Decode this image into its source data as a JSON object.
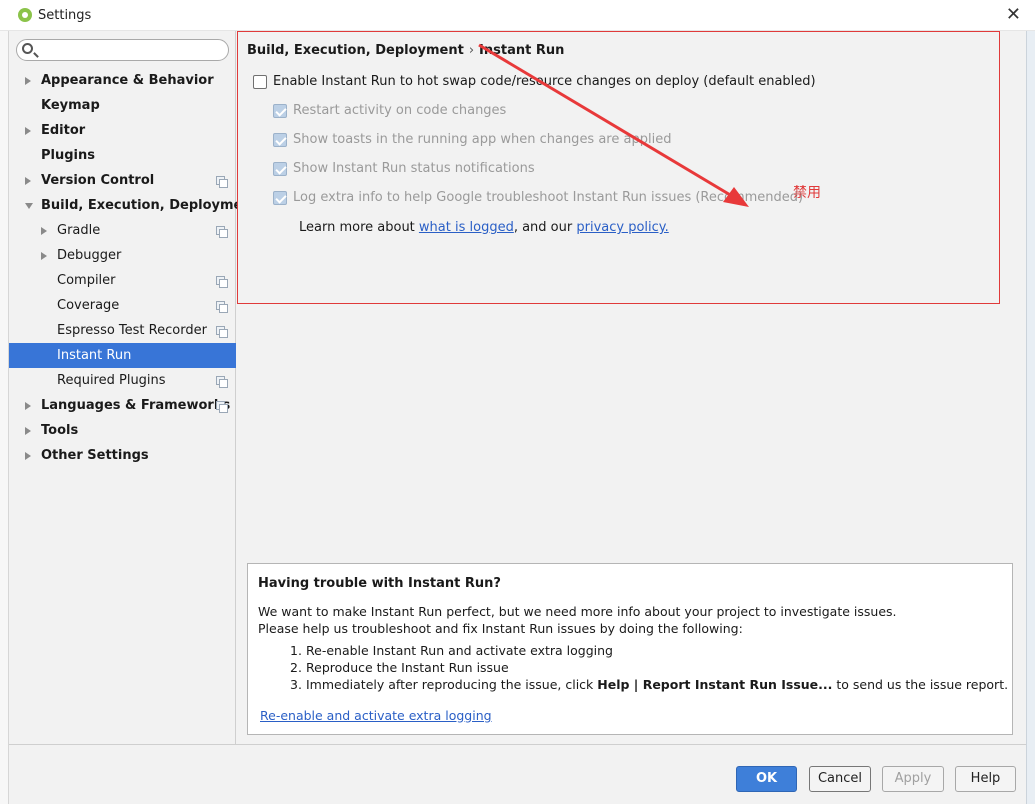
{
  "window": {
    "title": "Settings",
    "close_icon": "close-icon"
  },
  "search": {
    "value": "",
    "placeholder": ""
  },
  "sidebar": {
    "items": [
      {
        "label": "Appearance & Behavior",
        "bold": true,
        "arrow": "right",
        "indent": 0,
        "copy": false,
        "selected": false
      },
      {
        "label": "Keymap",
        "bold": true,
        "arrow": "none",
        "indent": 0,
        "copy": false,
        "selected": false
      },
      {
        "label": "Editor",
        "bold": true,
        "arrow": "right",
        "indent": 0,
        "copy": false,
        "selected": false
      },
      {
        "label": "Plugins",
        "bold": true,
        "arrow": "none",
        "indent": 0,
        "copy": false,
        "selected": false
      },
      {
        "label": "Version Control",
        "bold": true,
        "arrow": "right",
        "indent": 0,
        "copy": true,
        "selected": false
      },
      {
        "label": "Build, Execution, Deployment",
        "bold": true,
        "arrow": "down",
        "indent": 0,
        "copy": false,
        "selected": false
      },
      {
        "label": "Gradle",
        "bold": false,
        "arrow": "right",
        "indent": 1,
        "copy": true,
        "selected": false
      },
      {
        "label": "Debugger",
        "bold": false,
        "arrow": "right",
        "indent": 1,
        "copy": false,
        "selected": false
      },
      {
        "label": "Compiler",
        "bold": false,
        "arrow": "none",
        "indent": 1,
        "copy": true,
        "selected": false
      },
      {
        "label": "Coverage",
        "bold": false,
        "arrow": "none",
        "indent": 1,
        "copy": true,
        "selected": false
      },
      {
        "label": "Espresso Test Recorder",
        "bold": false,
        "arrow": "none",
        "indent": 1,
        "copy": true,
        "selected": false
      },
      {
        "label": "Instant Run",
        "bold": false,
        "arrow": "none",
        "indent": 1,
        "copy": false,
        "selected": true
      },
      {
        "label": "Required Plugins",
        "bold": false,
        "arrow": "none",
        "indent": 1,
        "copy": true,
        "selected": false
      },
      {
        "label": "Languages & Frameworks",
        "bold": true,
        "arrow": "right",
        "indent": 0,
        "copy": true,
        "selected": false
      },
      {
        "label": "Tools",
        "bold": true,
        "arrow": "right",
        "indent": 0,
        "copy": false,
        "selected": false
      },
      {
        "label": "Other Settings",
        "bold": true,
        "arrow": "right",
        "indent": 0,
        "copy": false,
        "selected": false
      }
    ]
  },
  "content": {
    "breadcrumb": {
      "parent": "Build, Execution, Deployment",
      "separator": "›",
      "current": "Instant Run"
    },
    "options": [
      {
        "label": "Enable Instant Run to hot swap code/resource changes on deploy (default enabled)",
        "checked": false,
        "disabled": false
      },
      {
        "label": "Restart activity on code changes",
        "checked": true,
        "disabled": true
      },
      {
        "label": "Show toasts in the running app when changes are applied",
        "checked": true,
        "disabled": true
      },
      {
        "label": "Show Instant Run status notifications",
        "checked": true,
        "disabled": true
      },
      {
        "label": "Log extra info to help Google troubleshoot Instant Run issues (Recommended)",
        "checked": true,
        "disabled": true
      }
    ],
    "learn": {
      "prefix": "Learn more about ",
      "link1": "what is logged",
      "middle": ", and our ",
      "link2": "privacy policy."
    },
    "annotation": "禁用",
    "annotation_color": "#e03a3a"
  },
  "trouble": {
    "title": "Having trouble with Instant Run?",
    "line1": "We want to make Instant Run perfect, but we need more info about your project to investigate issues.",
    "line2": "Please help us troubleshoot and fix Instant Run issues by doing the following:",
    "steps": [
      {
        "n": "1.",
        "text": "Re-enable Instant Run and activate extra logging"
      },
      {
        "n": "2.",
        "text": "Reproduce the Instant Run issue"
      },
      {
        "n": "3.",
        "prefix": "Immediately after reproducing the issue, click ",
        "bold": "Help | Report Instant Run Issue...",
        "suffix": " to send us the issue report."
      }
    ],
    "link": "Re-enable and activate extra logging"
  },
  "buttons": {
    "ok": "OK",
    "cancel": "Cancel",
    "apply": "Apply",
    "help": "Help"
  },
  "colors": {
    "accent": "#3875d7",
    "ok_button": "#3e7fd9",
    "link": "#2a5fc6"
  }
}
